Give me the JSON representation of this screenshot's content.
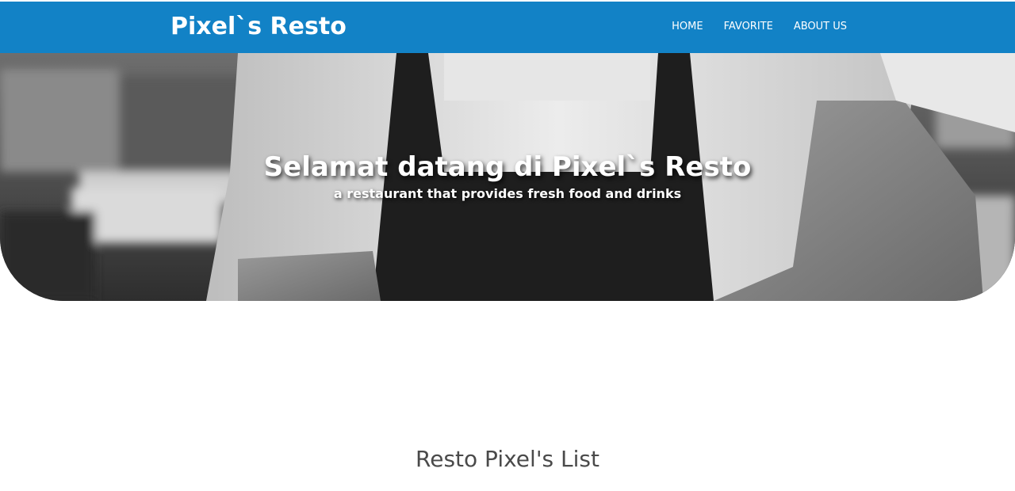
{
  "header": {
    "brand": "Pixel`s Resto",
    "nav": [
      {
        "label": "HOME"
      },
      {
        "label": "FAVORITE"
      },
      {
        "label": "ABOUT US"
      }
    ]
  },
  "hero": {
    "title": "Selamat datang di Pixel`s Resto",
    "subtitle": "a restaurant that provides fresh food and drinks"
  },
  "main": {
    "list_heading": "Resto Pixel's List"
  },
  "colors": {
    "app_bar": "#1282c6",
    "heading_text": "#4a4a4a"
  }
}
